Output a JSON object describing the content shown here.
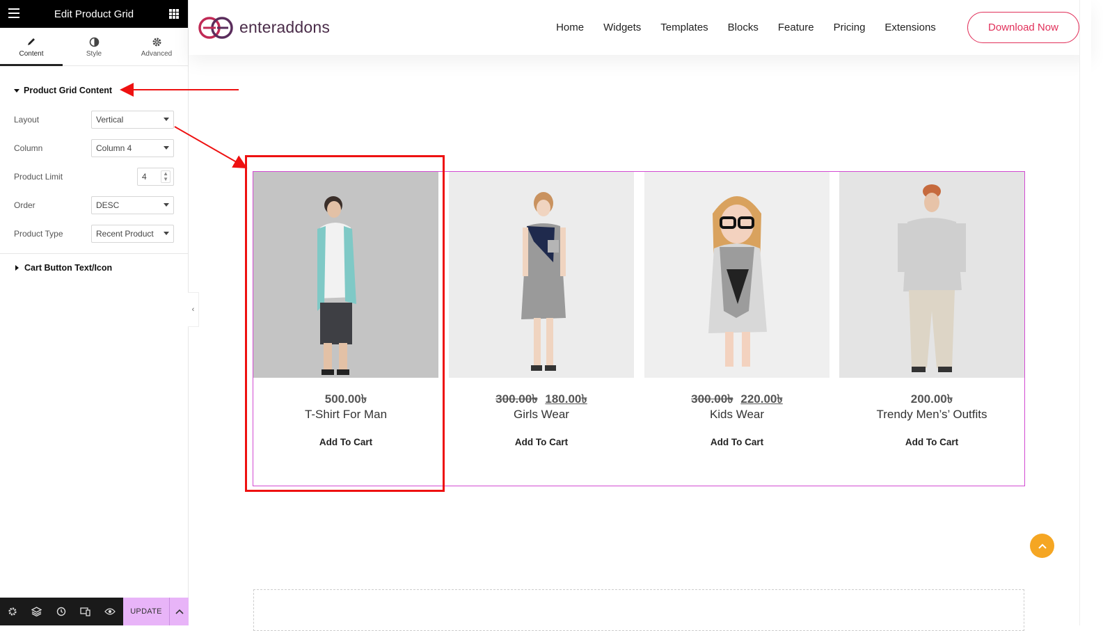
{
  "editor": {
    "title": "Edit Product Grid",
    "tabs": [
      {
        "label": "Content",
        "icon": "pencil-icon"
      },
      {
        "label": "Style",
        "icon": "half-circle-icon"
      },
      {
        "label": "Advanced",
        "icon": "gear-icon"
      }
    ],
    "section_title": "Product Grid Content",
    "controls": {
      "layout": {
        "label": "Layout",
        "value": "Vertical"
      },
      "column": {
        "label": "Column",
        "value": "Column 4"
      },
      "limit": {
        "label": "Product Limit",
        "value": "4"
      },
      "order": {
        "label": "Order",
        "value": "DESC"
      },
      "type": {
        "label": "Product Type",
        "value": "Recent Product"
      }
    },
    "section2_title": "Cart Button Text/Icon",
    "footer": {
      "update_label": "UPDATE"
    }
  },
  "site": {
    "logo_text": "enteraddons",
    "nav": [
      "Home",
      "Widgets",
      "Templates",
      "Blocks",
      "Feature",
      "Pricing",
      "Extensions"
    ],
    "cta": "Download Now"
  },
  "products": [
    {
      "old_price": "",
      "price": "500.00৳",
      "name": "T-Shirt For Man",
      "cart": "Add To Cart"
    },
    {
      "old_price": "300.00৳",
      "price": "180.00৳",
      "name": "Girls Wear",
      "cart": "Add To Cart"
    },
    {
      "old_price": "300.00৳",
      "price": "220.00৳",
      "name": "Kids Wear",
      "cart": "Add To Cart"
    },
    {
      "old_price": "",
      "price": "200.00৳",
      "name": "Trendy Men’s’ Outfits",
      "cart": "Add To Cart"
    }
  ],
  "colors": {
    "accent": "#e1305a",
    "logo": "#4a2c49",
    "grid_border": "#d24ad2",
    "highlight": "#ee1111",
    "scroll_top": "#f5a623",
    "update_bg": "#e8b4f8"
  }
}
